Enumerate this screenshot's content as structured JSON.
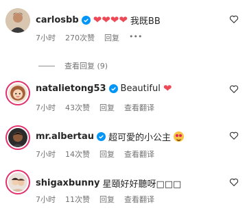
{
  "comments": [
    {
      "username": "carlosbb",
      "text": "我既BB",
      "hearts": "❤❤❤❤",
      "time": "7小时",
      "likes": "270次赞",
      "reply": "回复",
      "more": "•••",
      "view_replies": "查看回复 (9)"
    },
    {
      "username": "natalietong53",
      "text": "Beautiful",
      "hearts": "❤",
      "time": "7小时",
      "likes": "43次赞",
      "reply": "回复",
      "translate": "查看翻译"
    },
    {
      "username": "mr.albertau",
      "text": "超可愛的小公主",
      "time": "7小时",
      "likes": "14次赞",
      "reply": "回复",
      "translate": "查看翻译"
    },
    {
      "username": "shigaxbunny",
      "text": "星頤好好聽呀□□□",
      "time": "7小时",
      "likes": "11次赞",
      "reply": "回复",
      "translate": "查看翻译"
    }
  ],
  "colors": {
    "verified": "#0095f6",
    "heart": "#ed4956",
    "meta": "#737373"
  },
  "icons": [
    "verified-badge-icon",
    "heart-icon",
    "like-outline-icon",
    "more-icon",
    "smiling-heart-eyes-emoji"
  ]
}
